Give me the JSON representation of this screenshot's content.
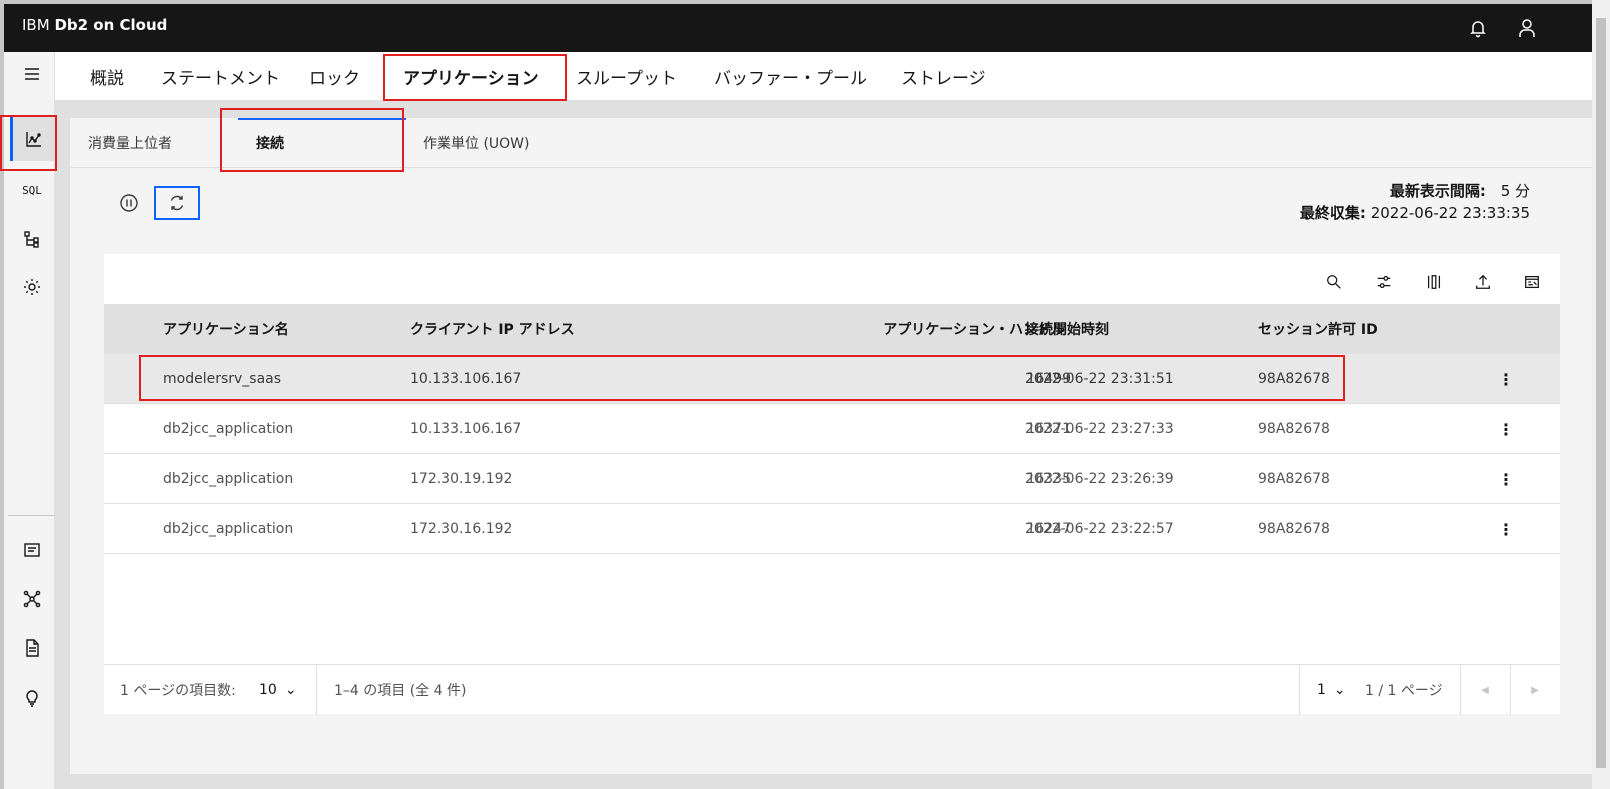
{
  "header": {
    "brand_prefix": "IBM",
    "brand_name": "Db2 on Cloud",
    "icons": [
      "notification-icon",
      "user-icon"
    ]
  },
  "rail": {
    "items": [
      "menu-icon",
      "monitor-chart-icon",
      "sql-icon",
      "schema-tree-icon",
      "settings-icon",
      "log-icon",
      "network-icon",
      "document-icon",
      "lightbulb-icon"
    ],
    "sql_label": "SQL"
  },
  "top_tabs": [
    "概説",
    "ステートメント",
    "ロック",
    "アプリケーション",
    "スループット",
    "バッファー・プール",
    "ストレージ"
  ],
  "top_tab_selected": "アプリケーション",
  "sub_tabs": [
    "消費量上位者",
    "接続",
    "作業単位 (UOW)"
  ],
  "sub_tab_selected": "接続",
  "refresh": {
    "interval_label": "最新表示間隔:",
    "interval_value": "5 分",
    "last_collected_label": "最終収集:",
    "last_collected_value": "2022-06-22 23:33:35"
  },
  "table": {
    "columns": [
      "アプリケーション名",
      "クライアント IP アドレス",
      "アプリケーション・ハンドル",
      "接続開始時刻",
      "セッション許可 ID"
    ],
    "rows": [
      {
        "app": "modelersrv_saas",
        "ip": "10.133.106.167",
        "handle": "16499",
        "start": "2022-06-22 23:31:51",
        "auth": "98A82678"
      },
      {
        "app": "db2jcc_application",
        "ip": "10.133.106.167",
        "handle": "16371",
        "start": "2022-06-22 23:27:33",
        "auth": "98A82678"
      },
      {
        "app": "db2jcc_application",
        "ip": "172.30.19.192",
        "handle": "16335",
        "start": "2022-06-22 23:26:39",
        "auth": "98A82678"
      },
      {
        "app": "db2jcc_application",
        "ip": "172.30.16.192",
        "handle": "16247",
        "start": "2022-06-22 23:22:57",
        "auth": "98A82678"
      }
    ],
    "toolbar_icons": [
      "search-icon",
      "filter-icon",
      "columns-icon",
      "export-icon",
      "sql-view-icon"
    ]
  },
  "pagination": {
    "items_per_page_label": "1 ページの項目数:",
    "items_per_page_value": "10",
    "range_text": "1–4 の項目 (全 4 件)",
    "page_value": "1",
    "page_total_text": "1 / 1 ページ"
  },
  "colors": {
    "header_bg": "#161616",
    "accent": "#0f62fe",
    "annotation_red": "#e02020"
  }
}
